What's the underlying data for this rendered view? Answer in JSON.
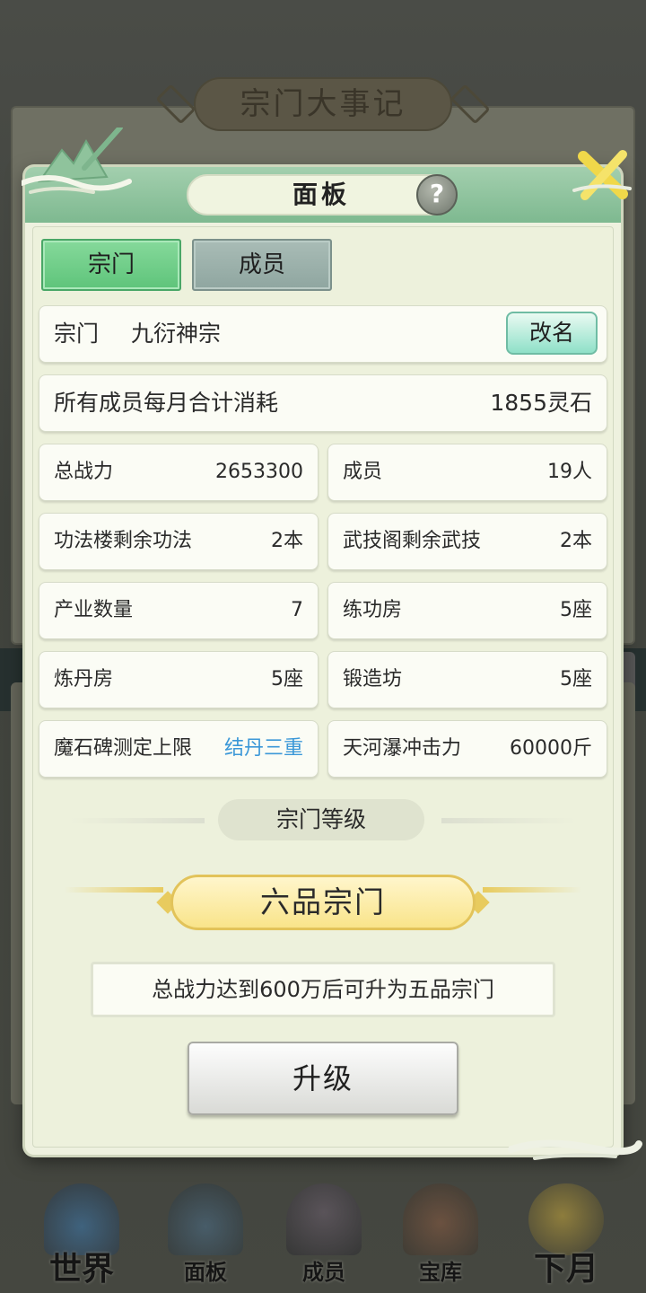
{
  "background": {
    "title": "宗门大事记"
  },
  "dialog": {
    "title": "面板",
    "help_icon": "question-mark-icon",
    "close_icon": "close-x-icon",
    "tabs": [
      {
        "label": "宗门",
        "active": true
      },
      {
        "label": "成员",
        "active": false
      }
    ],
    "sect": {
      "label": "宗门",
      "name": "九衍神宗",
      "rename_label": "改名"
    },
    "cost": {
      "label": "所有成员每月合计消耗",
      "value": "1855灵石"
    },
    "stats": [
      {
        "label": "总战力",
        "value": "2653300"
      },
      {
        "label": "成员",
        "value": "19人"
      },
      {
        "label": "功法楼剩余功法",
        "value": "2本"
      },
      {
        "label": "武技阁剩余武技",
        "value": "2本"
      },
      {
        "label": "产业数量",
        "value": "7"
      },
      {
        "label": "练功房",
        "value": "5座"
      },
      {
        "label": "炼丹房",
        "value": "5座"
      },
      {
        "label": "锻造坊",
        "value": "5座"
      },
      {
        "label": "魔石碑测定上限",
        "value": "结丹三重",
        "value_color": "#3c98d8"
      },
      {
        "label": "天河瀑冲击力",
        "value": "60000斤"
      }
    ],
    "level": {
      "header": "宗门等级",
      "rank": "六品宗门",
      "condition": "总战力达到600万后可升为五品宗门",
      "upgrade_label": "升级"
    }
  },
  "bottom_nav": [
    {
      "label": "世界",
      "icon": "world-temple-icon"
    },
    {
      "label": "面板",
      "icon": "panel-gate-icon"
    },
    {
      "label": "成员",
      "icon": "member-figure-icon"
    },
    {
      "label": "宝库",
      "icon": "treasury-pagoda-icon"
    },
    {
      "label": "下月",
      "icon": "crescent-moon-icon"
    }
  ],
  "colors": {
    "header_green": "#7eb990",
    "tab_active": "#5ec47a",
    "tab_inactive": "#8fa6a0",
    "highlight_blue": "#3c98d8",
    "badge_gold": "#f9e48a"
  }
}
